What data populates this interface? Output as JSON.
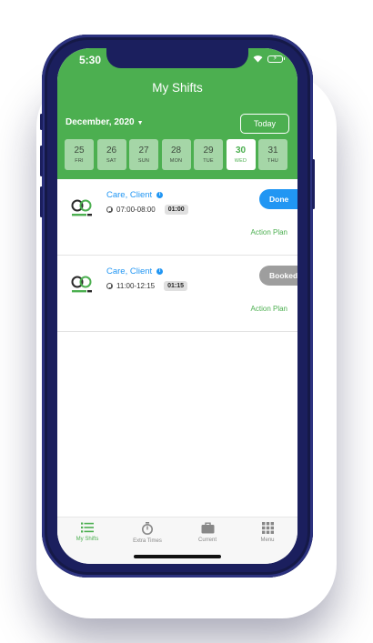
{
  "status_bar": {
    "time": "5:30"
  },
  "header": {
    "title": "My Shifts",
    "month": "December, 2020",
    "today_label": "Today"
  },
  "days": [
    {
      "num": "25",
      "weekday": "FRI",
      "selected": false
    },
    {
      "num": "26",
      "weekday": "SAT",
      "selected": false
    },
    {
      "num": "27",
      "weekday": "SUN",
      "selected": false
    },
    {
      "num": "28",
      "weekday": "MON",
      "selected": false
    },
    {
      "num": "29",
      "weekday": "TUE",
      "selected": false
    },
    {
      "num": "30",
      "weekday": "WED",
      "selected": true
    },
    {
      "num": "31",
      "weekday": "THU",
      "selected": false
    }
  ],
  "shifts": [
    {
      "client": "Care, Client",
      "time": "07:00-08:00",
      "duration": "01:00",
      "status": "Done",
      "status_color": "#2196f3",
      "action": "Action Plan"
    },
    {
      "client": "Care, Client",
      "time": "11:00-12:15",
      "duration": "01:15",
      "status": "Booked",
      "status_color": "#9e9e9e",
      "action": "Action Plan"
    }
  ],
  "tabs": [
    {
      "label": "My Shifts",
      "icon": "list-icon",
      "active": true
    },
    {
      "label": "Extra Times",
      "icon": "stopwatch-icon",
      "active": false
    },
    {
      "label": "Current",
      "icon": "briefcase-icon",
      "active": false
    },
    {
      "label": "Menu",
      "icon": "grid-icon",
      "active": false
    }
  ],
  "colors": {
    "primary": "#4caf50",
    "day_tile": "#a5d6a7",
    "link": "#2196f3",
    "phone_frame": "#1b1f5e"
  }
}
